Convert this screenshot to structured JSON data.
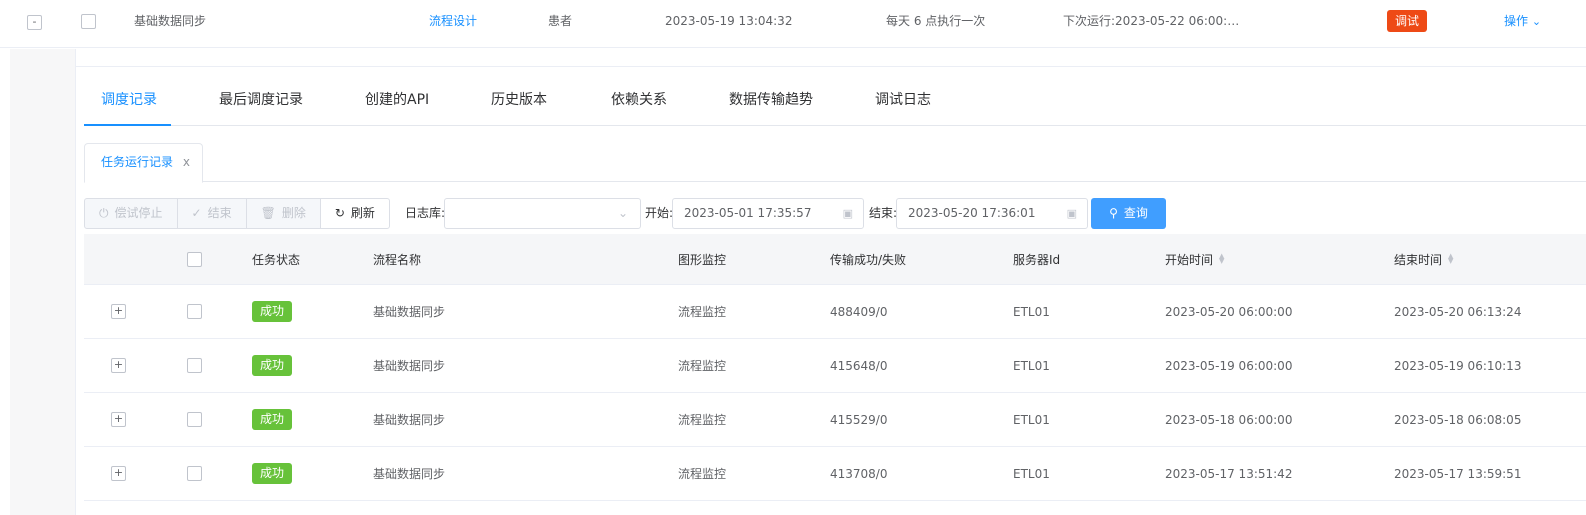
{
  "parent_row": {
    "expand": "-",
    "name": "基础数据同步",
    "design_link": "流程设计",
    "owner": "患者",
    "created": "2023-05-19 13:04:32",
    "schedule": "每天 6 点执行一次",
    "next_run": "下次运行:2023-05-22 06:00:…",
    "badge": "调试",
    "action": "操作",
    "action_icon": "chevron-down-icon"
  },
  "main_tabs": [
    "调度记录",
    "最后调度记录",
    "创建的API",
    "历史版本",
    "依赖关系",
    "数据传输趋势",
    "调试日志"
  ],
  "card_tab": {
    "label": "任务运行记录",
    "close": "x"
  },
  "toolbar": {
    "buttons": [
      {
        "label": "偿试停止",
        "icon": "power-icon"
      },
      {
        "label": "结束",
        "icon": "check-icon"
      },
      {
        "label": "删除",
        "icon": "trash-icon"
      },
      {
        "label": "刷新",
        "icon": "refresh-icon"
      }
    ],
    "log_label": "日志库:",
    "log_value": "",
    "start_label": "开始:",
    "start_value": "2023-05-01 17:35:57",
    "end_label": "结束:",
    "end_value": "2023-05-20 17:36:01",
    "query_label": "查询"
  },
  "table": {
    "headers": {
      "status": "任务状态",
      "name": "流程名称",
      "monitor": "图形监控",
      "transfer": "传输成功/失败",
      "server": "服务器Id",
      "start": "开始时间",
      "end": "结束时间"
    },
    "rows": [
      {
        "expand": "+",
        "status": "成功",
        "name": "基础数据同步",
        "monitor": "流程监控",
        "transfer": "488409/0",
        "server": "ETL01",
        "start": "2023-05-20 06:00:00",
        "end": "2023-05-20 06:13:24"
      },
      {
        "expand": "+",
        "status": "成功",
        "name": "基础数据同步",
        "monitor": "流程监控",
        "transfer": "415648/0",
        "server": "ETL01",
        "start": "2023-05-19 06:00:00",
        "end": "2023-05-19 06:10:13"
      },
      {
        "expand": "+",
        "status": "成功",
        "name": "基础数据同步",
        "monitor": "流程监控",
        "transfer": "415529/0",
        "server": "ETL01",
        "start": "2023-05-18 06:00:00",
        "end": "2023-05-18 06:08:05"
      },
      {
        "expand": "+",
        "status": "成功",
        "name": "基础数据同步",
        "monitor": "流程监控",
        "transfer": "413708/0",
        "server": "ETL01",
        "start": "2023-05-17 13:51:42",
        "end": "2023-05-17 13:59:51"
      }
    ]
  },
  "colors": {
    "accent": "#1890ff",
    "success": "#67c23a",
    "debug": "#ee4a16",
    "primary_button": "#409eff"
  }
}
